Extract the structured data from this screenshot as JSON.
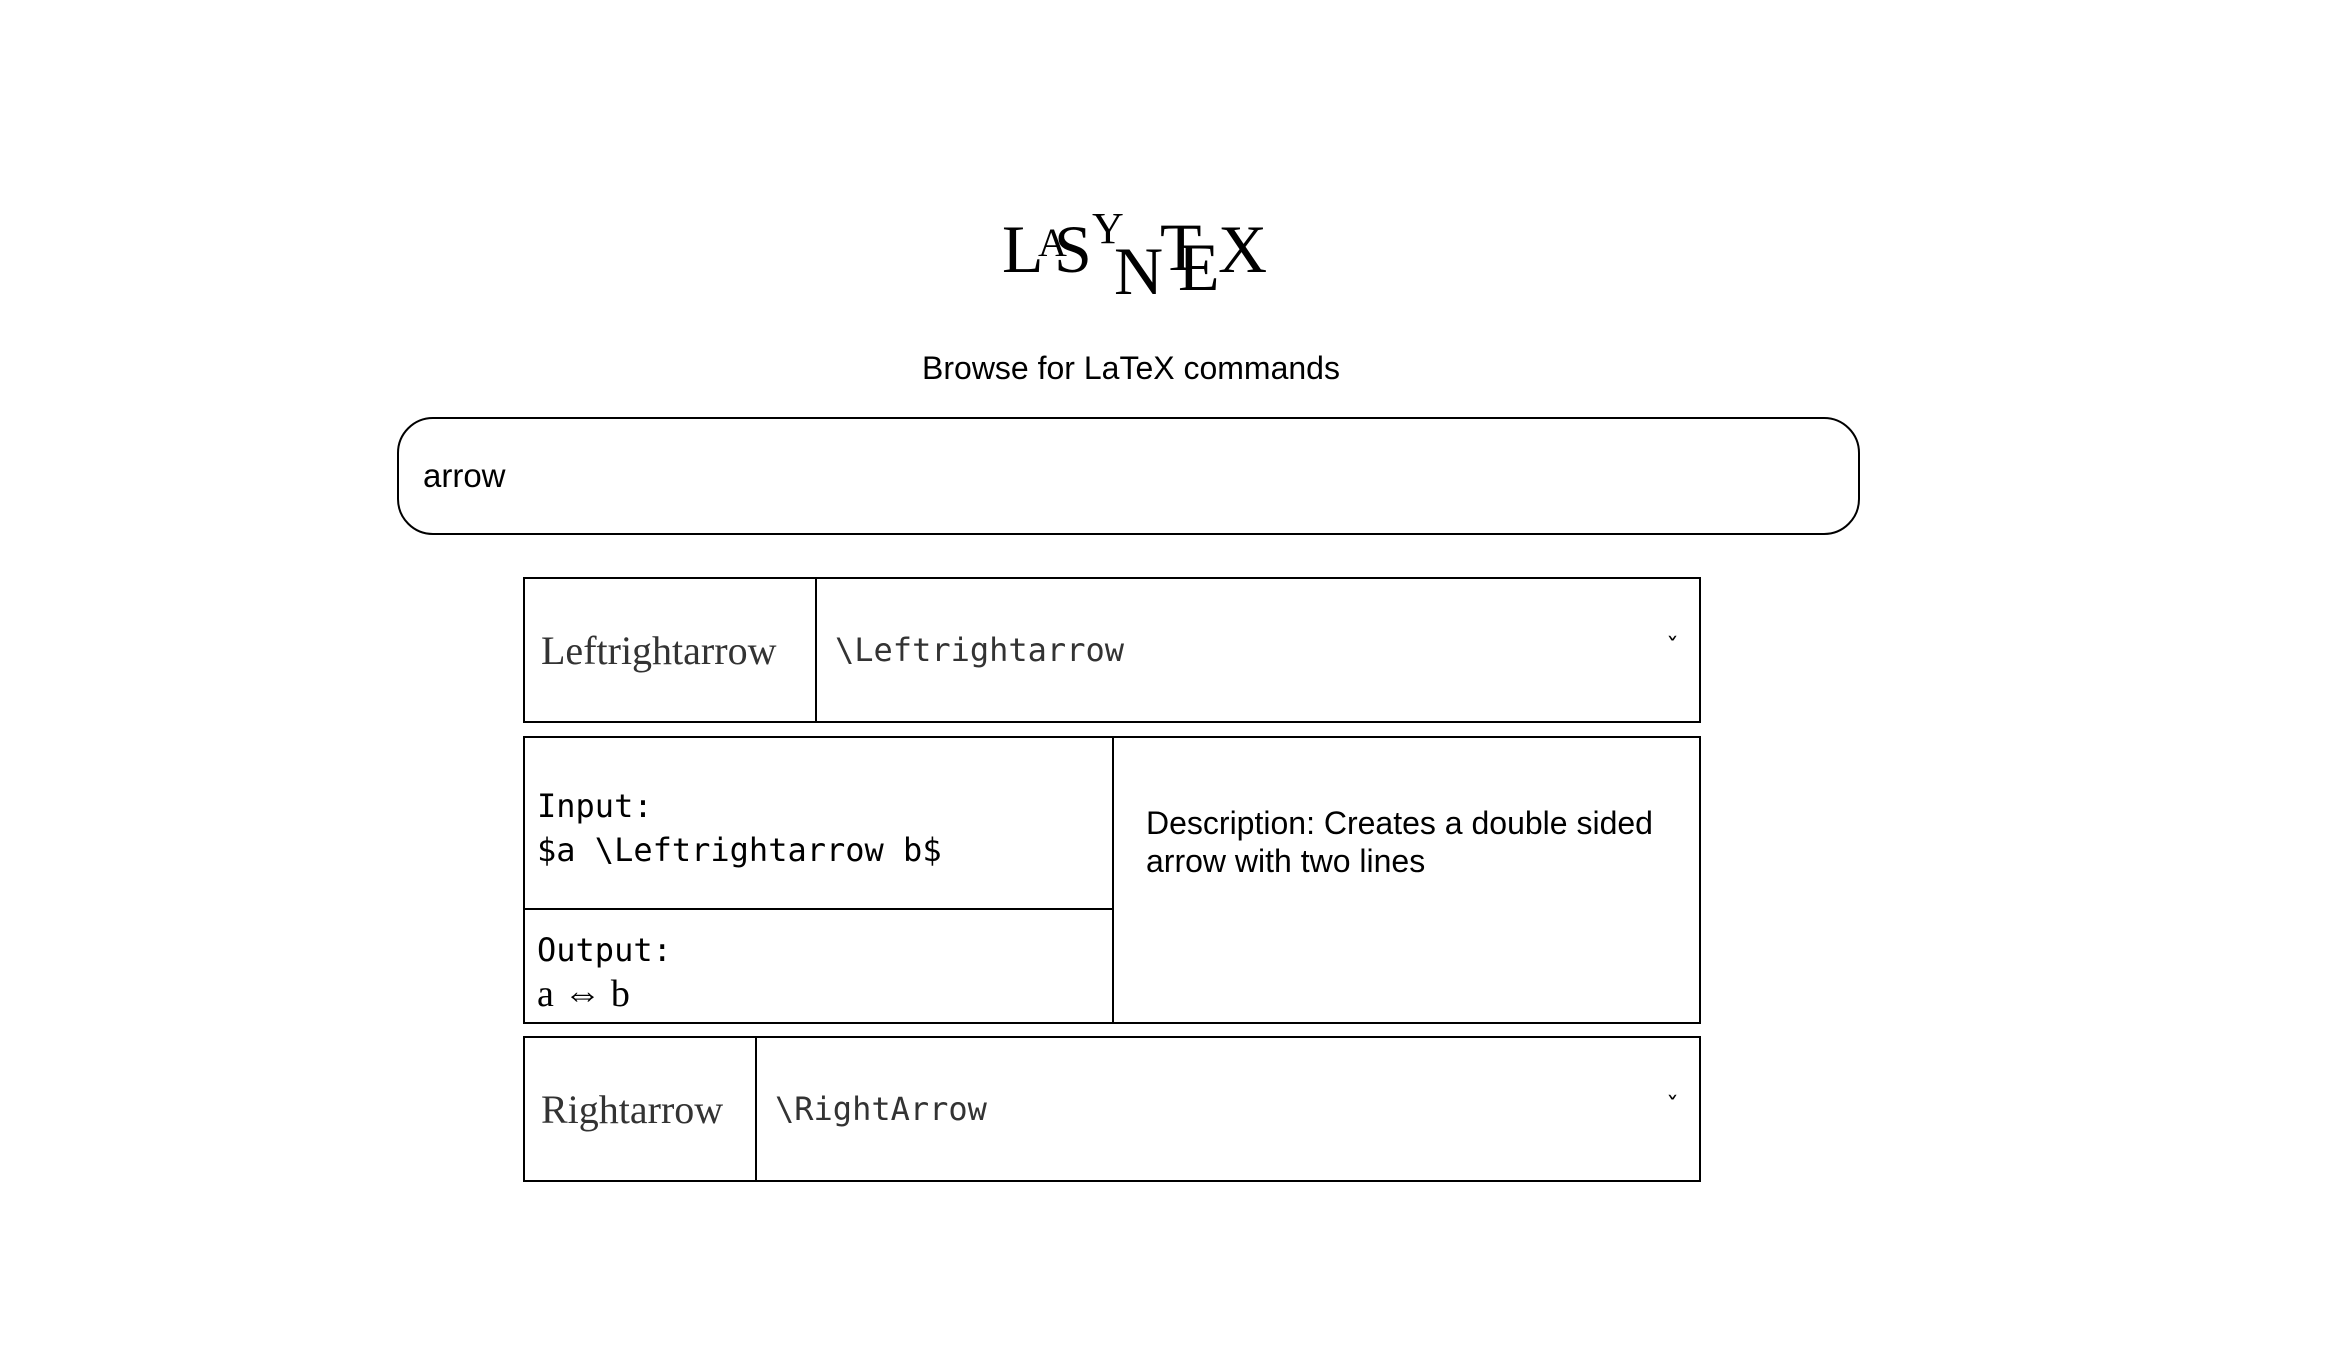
{
  "logo": {
    "letters": [
      "L",
      "A",
      "S",
      "Y",
      "N",
      "T",
      "E",
      "X"
    ]
  },
  "subtitle": "Browse for LaTeX commands",
  "search": {
    "value": "arrow",
    "placeholder": ""
  },
  "results": [
    {
      "name": "Leftrightarrow",
      "command": "\\Leftrightarrow",
      "expanded": true,
      "input_label": "Input:",
      "input_value": "$a \\Leftrightarrow b$",
      "output_label": "Output:",
      "output_value": "a ⇔ b",
      "description": "Description: Creates a double sided arrow with two lines"
    },
    {
      "name": "Rightarrow",
      "command": "\\RightArrow",
      "expanded": false
    }
  ],
  "icons": {
    "chevron": "chevron-down-icon",
    "chevron_glyph": "ˇ"
  }
}
